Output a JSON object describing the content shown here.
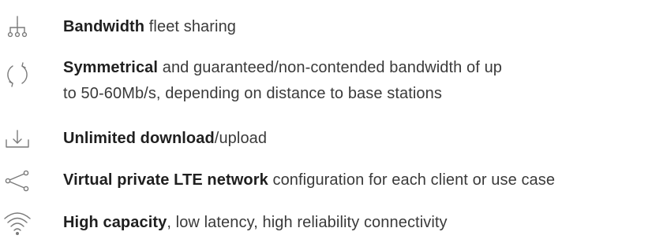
{
  "colors": {
    "icon": "#7a7a7a",
    "text": "#3a3a3a",
    "emphasis": "#1f1f1f"
  },
  "features": [
    {
      "icon": "network-hierarchy-icon",
      "bold": "Bandwidth",
      "rest": " fleet sharing"
    },
    {
      "icon": "sync-arrows-icon",
      "bold": "Symmetrical",
      "rest": " and guaranteed/non-contended bandwidth of up",
      "line2": "to 50-60Mb/s, depending on distance to base stations"
    },
    {
      "icon": "download-icon",
      "bold": "Unlimited download",
      "rest": "/upload"
    },
    {
      "icon": "share-nodes-icon",
      "bold": "Virtual private LTE network",
      "rest": " configuration for each client or use case"
    },
    {
      "icon": "wifi-icon",
      "bold": "High capacity",
      "rest": ", low latency, high reliability connectivity"
    }
  ]
}
